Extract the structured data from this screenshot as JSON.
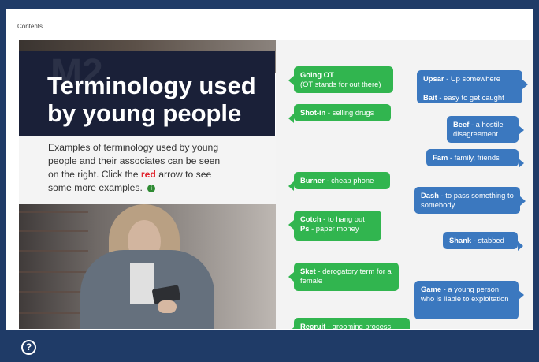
{
  "page": {
    "contents_label": "Contents",
    "title_watermark": "M2",
    "title": "Terminology used by young people",
    "intro": {
      "prefix": "Examples of terminology used by young people and their associates can be seen on the right. Click the ",
      "red_word": "red",
      "suffix": " arrow to see some more examples."
    }
  },
  "icons": {
    "info": "info-icon",
    "arrow_up": "arrow-up-icon",
    "arrow_down": "arrow-down-icon",
    "help": "question-mark-icon"
  },
  "terms": {
    "going_ot": {
      "term": "Going OT",
      "definition": "(OT stands for out there)"
    },
    "shot_in": {
      "term": "Shot-in",
      "definition": "- selling drugs"
    },
    "burner": {
      "term": "Burner",
      "definition": "- cheap phone"
    },
    "cotch": {
      "term": "Cotch",
      "definition": "- to hang out"
    },
    "ps": {
      "term": "Ps",
      "definition": "- paper money"
    },
    "sket": {
      "term": "Sket",
      "definition": "- derogatory term for a female"
    },
    "recruit": {
      "term": "Recruit",
      "definition": "- grooming process"
    },
    "upsar": {
      "term": "Upsar",
      "definition": "- Up somewhere"
    },
    "bait": {
      "term": "Bait",
      "definition": "- easy to get caught"
    },
    "beef": {
      "term": "Beef",
      "definition": "- a hostile disagreement"
    },
    "fam": {
      "term": "Fam",
      "definition": "- family, friends"
    },
    "dash": {
      "term": "Dash",
      "definition": "- to pass something to somebody"
    },
    "shank": {
      "term": "Shank",
      "definition": "- stabbed"
    },
    "game": {
      "term": "Game",
      "definition": "- a young person who is liable to exploitation"
    }
  },
  "bottom": {
    "help": "?"
  },
  "colors": {
    "background": "#1f3b67",
    "green_bubble": "#31b54f",
    "blue_bubble": "#3b78bf",
    "red_accent": "#e0252f",
    "title_bg": "#1a2038"
  }
}
